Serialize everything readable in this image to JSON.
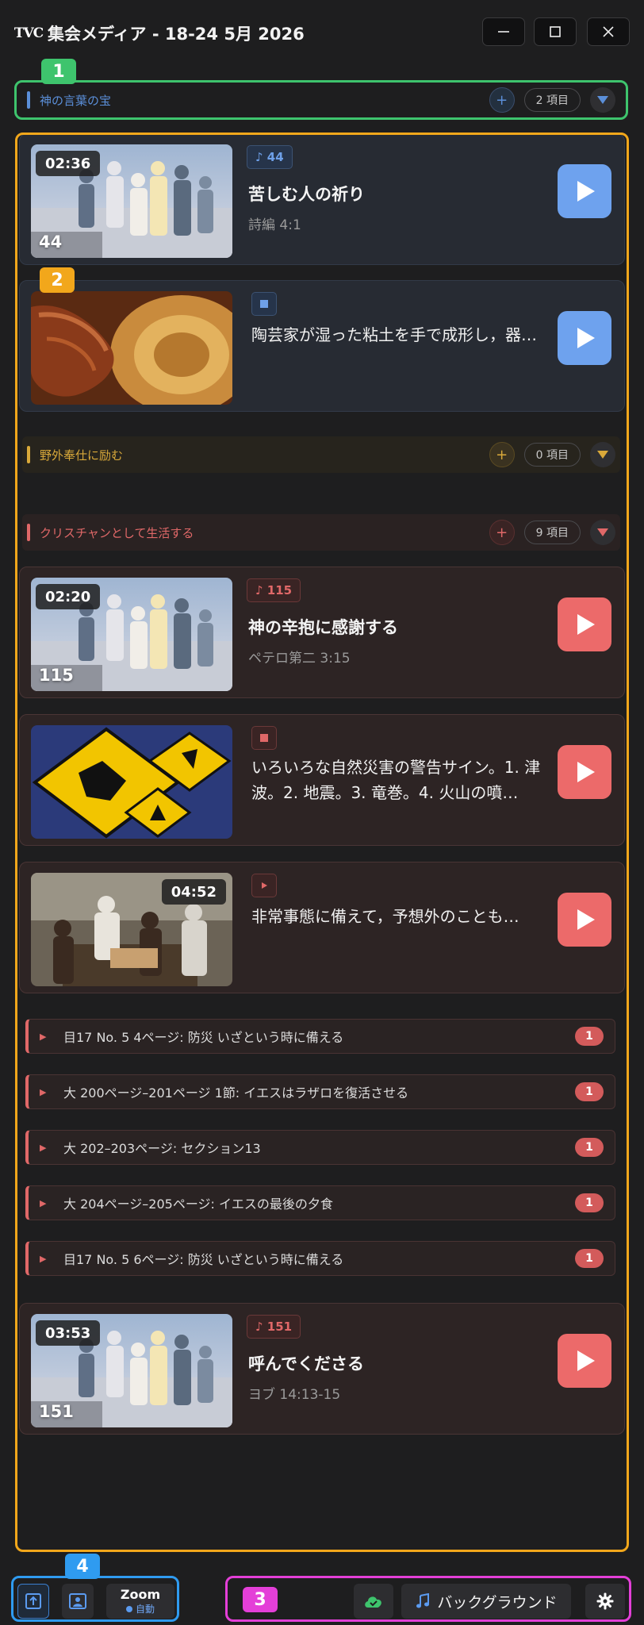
{
  "app": {
    "logo": "TVC",
    "title": "集会メディア - 18-24 5月 2026"
  },
  "annotations": [
    "1",
    "2",
    "3",
    "4"
  ],
  "colors": {
    "blue": "#5b8fd9",
    "yellow": "#d9a93a",
    "red": "#e06868",
    "green": "#3ec46d",
    "orange": "#f2a71b",
    "pink": "#e43fd8",
    "cyan": "#2f9bf0"
  },
  "sections": [
    {
      "title": "神の言葉の宝",
      "count": "2 項目",
      "items": [
        {
          "duration": "02:36",
          "number": "44",
          "tag": "♪ 44",
          "title": "苦しむ人の祈り",
          "subtitle": "詩編 4:1"
        },
        {
          "tag_icon": "image-icon",
          "description": "陶芸家が湿った粘土を手で成形し，器…"
        }
      ]
    },
    {
      "title": "野外奉仕に励む",
      "count": "0 項目"
    },
    {
      "title": "クリスチャンとして生活する",
      "count": "9 項目",
      "items": [
        {
          "duration": "02:20",
          "number": "115",
          "tag": "♪ 115",
          "title": "神の辛抱に感謝する",
          "subtitle": "ペテロ第二 3:15"
        },
        {
          "tag_icon": "image-icon",
          "description": "いろいろな自然災害の警告サイン。1. 津波。2. 地震。3. 竜巻。4. 火山の噴…"
        },
        {
          "duration": "04:52",
          "tag_icon": "video-icon",
          "description": "非常事態に備えて，予想外のことも…"
        }
      ],
      "references": [
        {
          "label": "目17 No. 5 4ページ: 防災 いざという時に備える",
          "count": "1"
        },
        {
          "label": "大 200ページ–201ページ 1節: イエスはラザロを復活させる",
          "count": "1"
        },
        {
          "label": "大 202–203ページ: セクション13",
          "count": "1"
        },
        {
          "label": "大 204ページ–205ページ: イエスの最後の夕食",
          "count": "1"
        },
        {
          "label": "目17 No. 5 6ページ: 防災 いざという時に備える",
          "count": "1"
        }
      ],
      "closing": {
        "duration": "03:53",
        "number": "151",
        "tag": "♪ 151",
        "title": "呼んでくださる",
        "subtitle": "ヨブ 14:13-15"
      }
    }
  ],
  "footer": {
    "zoom_label": "Zoom",
    "zoom_mode": "自動",
    "background_label": "バックグラウンド"
  }
}
